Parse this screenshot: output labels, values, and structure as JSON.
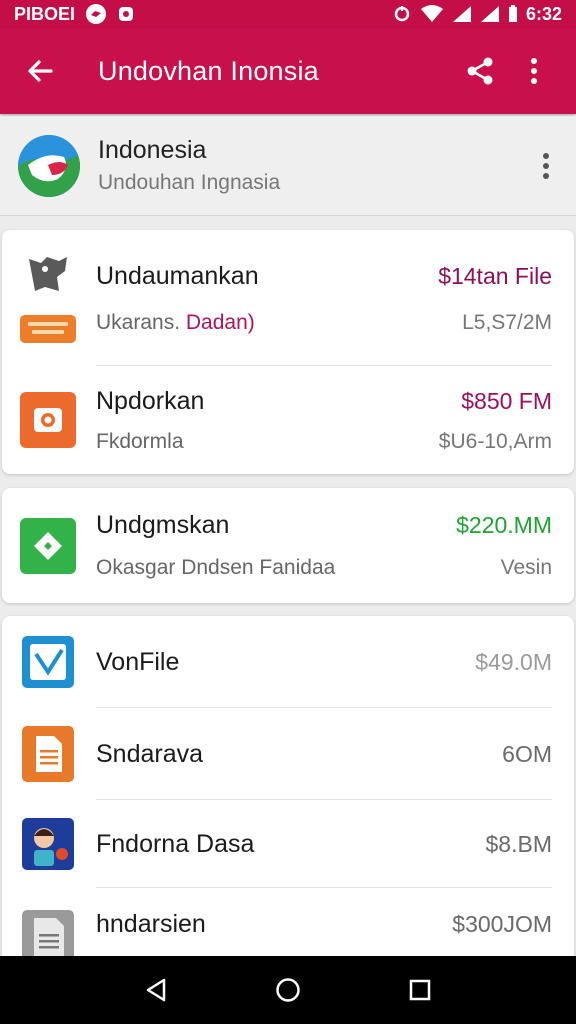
{
  "status_bar": {
    "left_text": "PIBOEI",
    "left_icons": [
      "circle-logo-icon",
      "notification-app-icon"
    ],
    "right_icons": [
      "vpn-key-icon",
      "wifi-icon",
      "signal-icon",
      "signal-icon-2"
    ],
    "time": "6:32"
  },
  "app_bar": {
    "title": "Undovhan Inonsia",
    "back_icon": "back-arrow-icon",
    "share_icon": "share-icon",
    "menu_icon": "more-vert-icon",
    "color": "#c8104c"
  },
  "header": {
    "title": "Indonesia",
    "subtitle": "Undouhan Ingnasia"
  },
  "cards": [
    {
      "rows": [
        {
          "title": "Undaumankan",
          "value": "$14tan File",
          "value_color": "#8e0f58",
          "sub": "Ukarans. ",
          "sub_accent": "Dadan)",
          "sub_accent_color": "#b0125a",
          "value2": "L5,S7/2M",
          "icon": "file-gray-icon"
        },
        {
          "title": "Npdorkan",
          "value": "$850 FM",
          "value_color": "#9a0f60",
          "sub": "Fkdormla",
          "sub_accent": "",
          "sub_accent_color": "",
          "value2": "$U6-10,Arm",
          "icon": "camera-orange-icon"
        }
      ]
    },
    {
      "rows": [
        {
          "title": "Undgmskan",
          "value": "$220.MM",
          "value_color": "#1fa331",
          "sub": "Okasgar Dndsen Fanidaa",
          "sub_accent": "",
          "sub_accent_color": "",
          "value2": "Vesin",
          "icon": "green-app-icon"
        }
      ]
    },
    {
      "rows": [
        {
          "title": "VonFile",
          "value": "$49.0M",
          "value_color": "#9a9a9a",
          "icon": "blue-check-icon"
        },
        {
          "title": "Sndarava",
          "value": "6OM",
          "value_color": "#6a6a6a",
          "icon": "document-orange-icon"
        },
        {
          "title": "Fndorna Dasa",
          "value": "$8.BM",
          "value_color": "#6a6a6a",
          "icon": "character-app-icon"
        },
        {
          "title": "hndarsien",
          "value": "$300JOM",
          "value_color": "#6a6a6a",
          "icon": "document-gray-icon"
        }
      ]
    }
  ],
  "nav_bar": {
    "back_icon": "nav-back-icon",
    "home_icon": "nav-home-icon",
    "recents_icon": "nav-recents-icon"
  }
}
